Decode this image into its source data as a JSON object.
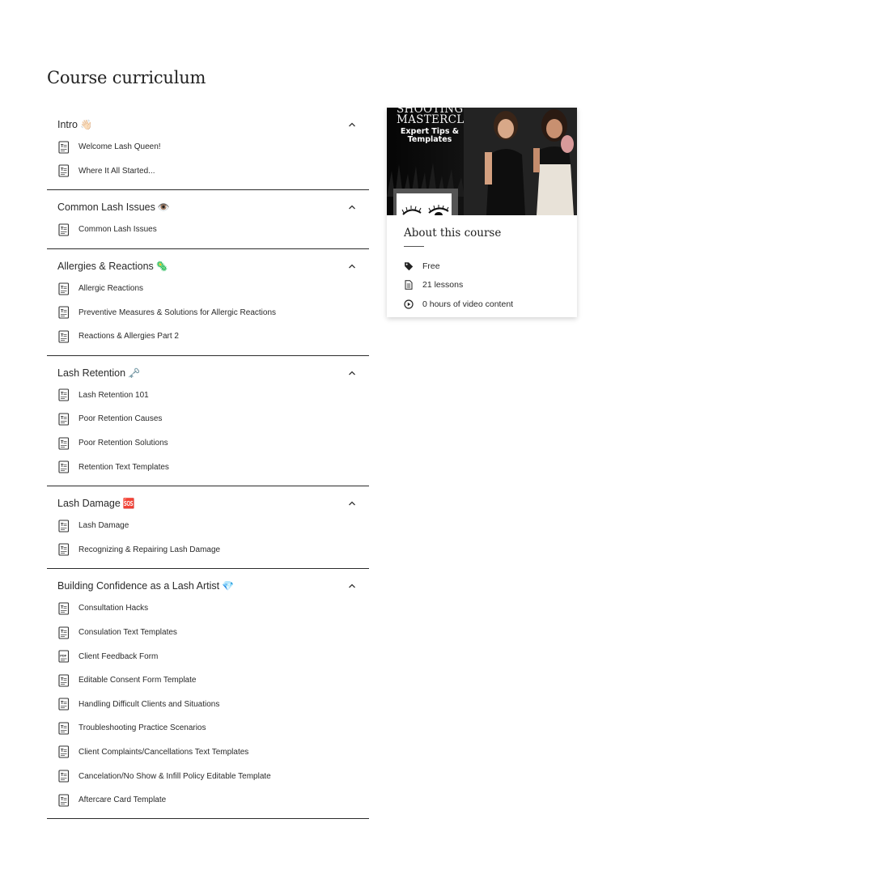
{
  "page": {
    "title": "Course curriculum"
  },
  "sections": [
    {
      "title": "Intro",
      "emoji": "👋🏻",
      "lessons": [
        {
          "label": "Welcome Lash Queen!",
          "type": "text"
        },
        {
          "label": "Where It All Started...",
          "type": "text"
        }
      ]
    },
    {
      "title": "Common Lash Issues",
      "emoji": "👁️",
      "lessons": [
        {
          "label": "Common Lash Issues",
          "type": "text"
        }
      ]
    },
    {
      "title": "Allergies & Reactions",
      "emoji": "🦠",
      "lessons": [
        {
          "label": "Allergic Reactions",
          "type": "text"
        },
        {
          "label": "Preventive Measures & Solutions for Allergic Reactions",
          "type": "text"
        },
        {
          "label": "Reactions & Allergies Part 2",
          "type": "text"
        }
      ]
    },
    {
      "title": "Lash Retention",
      "emoji": "🗝️",
      "lessons": [
        {
          "label": "Lash Retention 101",
          "type": "text"
        },
        {
          "label": "Poor Retention Causes",
          "type": "text"
        },
        {
          "label": "Poor Retention Solutions",
          "type": "text"
        },
        {
          "label": "Retention Text Templates",
          "type": "text"
        }
      ]
    },
    {
      "title": "Lash Damage",
      "emoji": "🆘",
      "lessons": [
        {
          "label": "Lash Damage",
          "type": "text"
        },
        {
          "label": "Recognizing & Repairing Lash Damage",
          "type": "text"
        }
      ]
    },
    {
      "title": "Building Confidence as a Lash Artist",
      "emoji": "💎",
      "lessons": [
        {
          "label": "Consultation Hacks",
          "type": "text"
        },
        {
          "label": "Consulation Text Templates",
          "type": "text"
        },
        {
          "label": "Client Feedback Form",
          "type": "pdf"
        },
        {
          "label": "Editable Consent Form Template",
          "type": "text"
        },
        {
          "label": "Handling Difficult Clients and Situations",
          "type": "text"
        },
        {
          "label": "Troubleshooting Practice Scenarios",
          "type": "text"
        },
        {
          "label": "Client Complaints/Cancellations Text Templates",
          "type": "text"
        },
        {
          "label": "Cancelation/No Show & Infill Policy Editable Template",
          "type": "text"
        },
        {
          "label": "Aftercare Card Template",
          "type": "text"
        }
      ]
    }
  ],
  "card": {
    "thumbnail": {
      "title_line1": "SHOOTING",
      "title_line2": "MASTERCLASS",
      "subtitle_line1": "Expert Tips &",
      "subtitle_line2": "Templates"
    },
    "title": "About this course",
    "info": [
      {
        "icon": "price-tag-icon",
        "text": "Free"
      },
      {
        "icon": "document-icon",
        "text": "21 lessons"
      },
      {
        "icon": "play-circle-icon",
        "text": "0 hours of video content"
      }
    ]
  },
  "colors": {
    "text": "#2a2a2a",
    "divider": "#2b2b2b",
    "thumbnail_bg": "#111111"
  }
}
